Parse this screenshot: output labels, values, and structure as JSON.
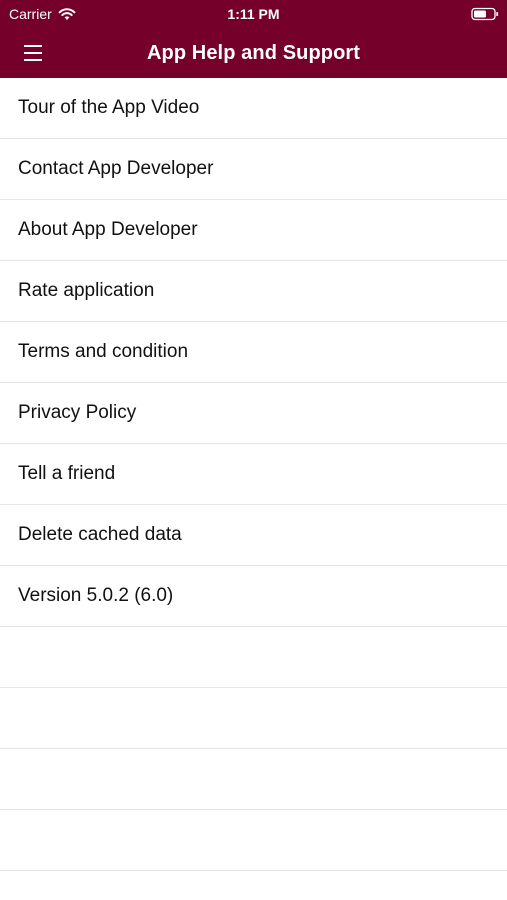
{
  "status_bar": {
    "carrier": "Carrier",
    "time": "1:11 PM"
  },
  "nav": {
    "title": "App Help and Support",
    "menu_icon": "hamburger-menu-icon"
  },
  "menu_items": [
    {
      "label": "Tour of the App Video"
    },
    {
      "label": "Contact App Developer"
    },
    {
      "label": "About App Developer"
    },
    {
      "label": "Rate application"
    },
    {
      "label": "Terms and condition"
    },
    {
      "label": "Privacy Policy"
    },
    {
      "label": "Tell a friend"
    },
    {
      "label": "Delete cached data"
    },
    {
      "label": "Version 5.0.2 (6.0)"
    }
  ],
  "colors": {
    "nav_background": "#75002a",
    "separator": "#e6e6e6"
  }
}
